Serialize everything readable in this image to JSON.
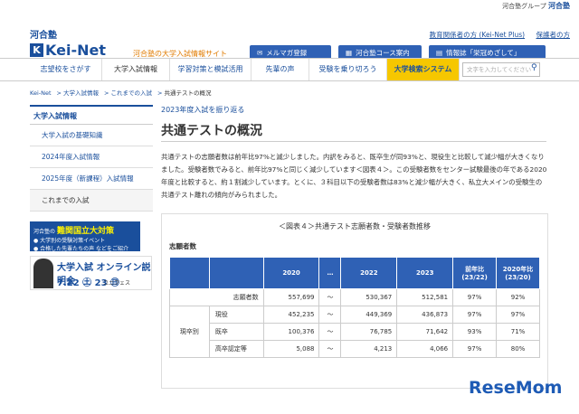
{
  "topbar": {
    "group_label": "河合塾グループ",
    "group_brand": "河合塾"
  },
  "header": {
    "logo_ja": "河合塾",
    "logo_mark": "K",
    "logo_en": "Kei-Net",
    "tagline": "河合塾の大学入試情報サイト",
    "links": [
      "教育関係者の方 (Kei-Net Plus)",
      "保護者の方"
    ],
    "buttons": [
      {
        "icon": "✉",
        "label": "メルマガ登録"
      },
      {
        "icon": "▦",
        "label": "河合塾コース案内"
      },
      {
        "icon": "▤",
        "label": "情報誌「栄冠めざして」"
      }
    ]
  },
  "nav": {
    "items": [
      "志望校をさがす",
      "大学入試情報",
      "学習対策と模試活用",
      "先輩の声",
      "受験を乗り切ろう",
      "大学検索システム"
    ],
    "search_placeholder": "文字を入力してください",
    "search_icon": "search-icon"
  },
  "breadcrumb": [
    "Kei-Net",
    "大学入試情報",
    "これまでの入試",
    "共通テストの概況"
  ],
  "sidebar": {
    "heading": "大学入試情報",
    "items": [
      "大学入試の基礎知識",
      "2024年度入試情報",
      "2025年度（新課程）入試情報",
      "これまでの入試"
    ]
  },
  "banner1": {
    "brand": "河合塾の",
    "title": "難関国立大対策",
    "line1": "● 大学別の受験対策イベント",
    "line2": "● 合格した先輩たちの声 などをご紹介"
  },
  "banner2": {
    "t1": "大学入試 オンライン説明会",
    "t2": "7.22 ㊏ 23 ㊐",
    "t3": "ユニフェス"
  },
  "article": {
    "kicker": "2023年度入試を振り返る",
    "title": "共通テストの概況",
    "body": "共通テストの志願者数は前年比97%と減少しました。内訳をみると、既卒生が同93%と、現役生と比較して減少幅が大きくなりました。受験者数でみると、前年比97%と同じく減少しています＜図表４＞。この受験者数をセンター試験最後の年である2020年度と比較すると、約１割減少しています。とくに、３科目以下の受験者数は83%と減少幅が大きく、私立大メインの受験生の共通テスト離れの傾向がみられました。"
  },
  "figure": {
    "title": "＜図表４＞共通テスト志願者数・受験者数推移",
    "subtitle": "志願者数",
    "headers": [
      "2020",
      "…",
      "2022",
      "2023",
      "前年比\n(23/22)",
      "2020年比\n(23/20)"
    ],
    "rows": [
      {
        "group": "",
        "label": "志願者数",
        "values": [
          "557,699",
          "～",
          "530,367",
          "512,581",
          "97%",
          "92%"
        ]
      },
      {
        "group": "現卒別",
        "label": "現役",
        "values": [
          "452,235",
          "～",
          "449,369",
          "436,873",
          "97%",
          "97%"
        ]
      },
      {
        "group": "",
        "label": "既卒",
        "values": [
          "100,376",
          "～",
          "76,785",
          "71,642",
          "93%",
          "71%"
        ]
      },
      {
        "group": "",
        "label": "高卒認定等",
        "values": [
          "5,088",
          "～",
          "4,213",
          "4,066",
          "97%",
          "80%"
        ]
      }
    ]
  },
  "watermark": "ReseMom"
}
